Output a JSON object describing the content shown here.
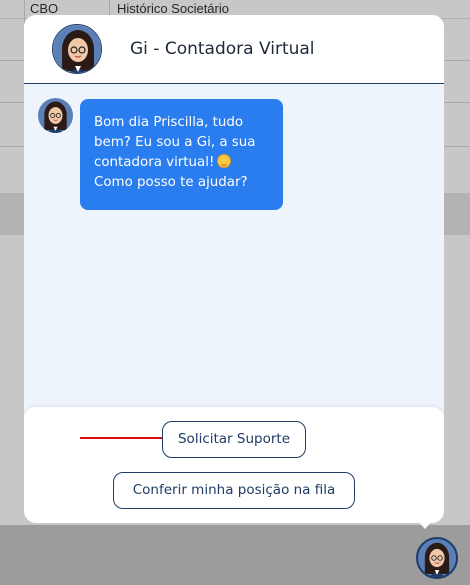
{
  "background": {
    "columns": [
      "CBO",
      "Histórico Societário"
    ]
  },
  "chat": {
    "title": "Gi - Contadora Virtual",
    "message_lines": [
      "Bom dia Priscilla, tudo",
      "bem? Eu sou a Gi, a sua",
      "contadora virtual!",
      "Como posso te ajudar?"
    ],
    "buttons": {
      "request_support": "Solicitar Suporte",
      "queue_position": "Conferir minha posição na fila"
    }
  },
  "icons": {
    "avatar": "assistant-avatar-icon",
    "emoji": "smiling-face-with-hearts-icon",
    "arrow": "red-right-arrow-icon"
  },
  "colors": {
    "accent": "#2a7def",
    "navy": "#1f3c67",
    "chat_bg": "#eef4fb",
    "arrow": "#e01010"
  }
}
